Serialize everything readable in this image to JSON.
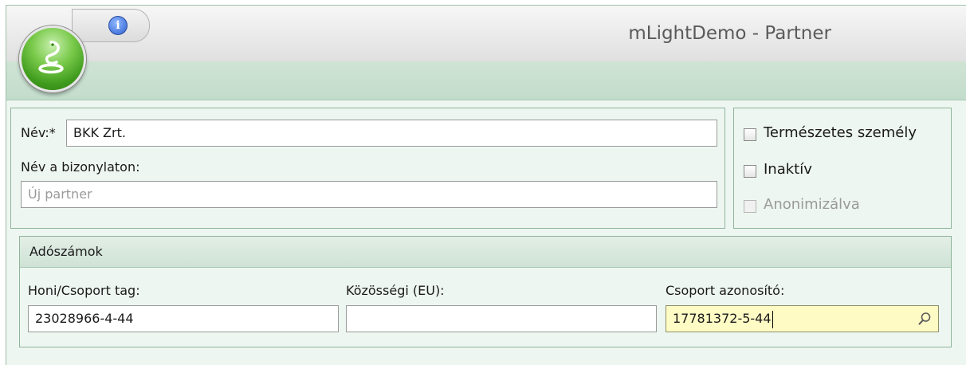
{
  "window": {
    "title": "mLightDemo - Partner",
    "info_glyph": "i"
  },
  "partner": {
    "name_label": "Név:*",
    "name_value": "BKK Zrt.",
    "doc_name_label": "Név a bizonylaton:",
    "doc_name_placeholder": "Új partner"
  },
  "options": {
    "natural_person_label": "Természetes személy",
    "inactive_label": "Inaktív",
    "anonymized_label": "Anonimizálva"
  },
  "tax_numbers": {
    "header": "Adószámok",
    "domestic_label": "Honi/Csoport tag:",
    "domestic_value": "23028966-4-44",
    "eu_label": "Közösségi (EU):",
    "eu_value": "",
    "group_id_label": "Csoport azonosító:",
    "group_id_value": "17781372-5-44"
  },
  "colors": {
    "accent_green": "#3f9b1d",
    "panel_bg": "#eef6f1",
    "highlight_field": "#fffbc4"
  },
  "icons": {
    "app_orb": "snake-logo-icon",
    "info": "info-icon",
    "lookup": "search-icon"
  }
}
